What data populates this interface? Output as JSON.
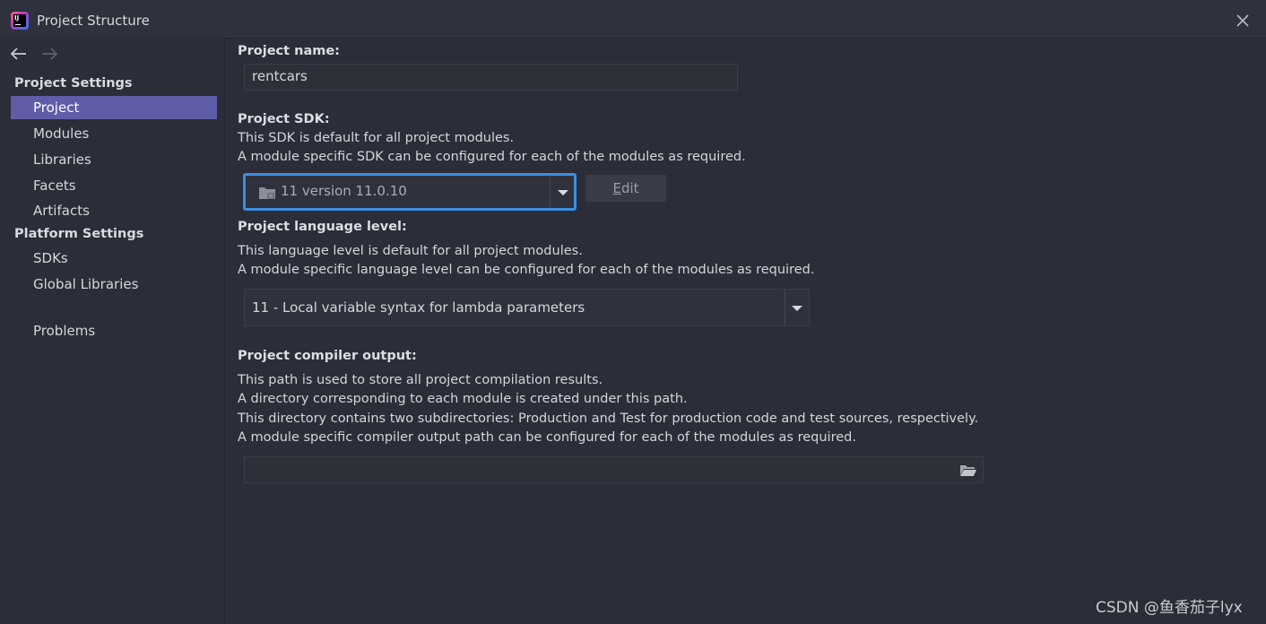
{
  "window": {
    "title": "Project Structure",
    "logo_text": "IJ"
  },
  "sidebar": {
    "project_settings_header": "Project Settings",
    "project_settings_items": [
      {
        "label": "Project",
        "selected": true
      },
      {
        "label": "Modules",
        "selected": false
      },
      {
        "label": "Libraries",
        "selected": false
      },
      {
        "label": "Facets",
        "selected": false
      },
      {
        "label": "Artifacts",
        "selected": false
      }
    ],
    "platform_settings_header": "Platform Settings",
    "platform_settings_items": [
      {
        "label": "SDKs"
      },
      {
        "label": "Global Libraries"
      }
    ],
    "problems_label": "Problems"
  },
  "main": {
    "project_name": {
      "label": "Project name:",
      "value": "rentcars"
    },
    "project_sdk": {
      "label": "Project SDK:",
      "desc_lines": [
        "This SDK is default for all project modules.",
        "A module specific SDK can be configured for each of the modules as required."
      ],
      "selected": "11 version 11.0.10",
      "edit_mnemonic": "E",
      "edit_rest": "dit"
    },
    "language_level": {
      "label": "Project language level:",
      "desc_lines": [
        "This language level is default for all project modules.",
        "A module specific language level can be configured for each of the modules as required."
      ],
      "selected": "11 - Local variable syntax for lambda parameters"
    },
    "compiler_output": {
      "label": "Project compiler output:",
      "desc_lines": [
        "This path is used to store all project compilation results.",
        "A directory corresponding to each module is created under this path.",
        "This directory contains two subdirectories: Production and Test for production code and test sources, respectively.",
        "A module specific compiler output path can be configured for each of the modules as required."
      ],
      "value": ""
    }
  },
  "watermark": "CSDN @鱼香茄子lyx",
  "colors": {
    "background": "#2b2d38",
    "selection": "#5f5ca8",
    "focus_border": "#3b8fe0"
  }
}
